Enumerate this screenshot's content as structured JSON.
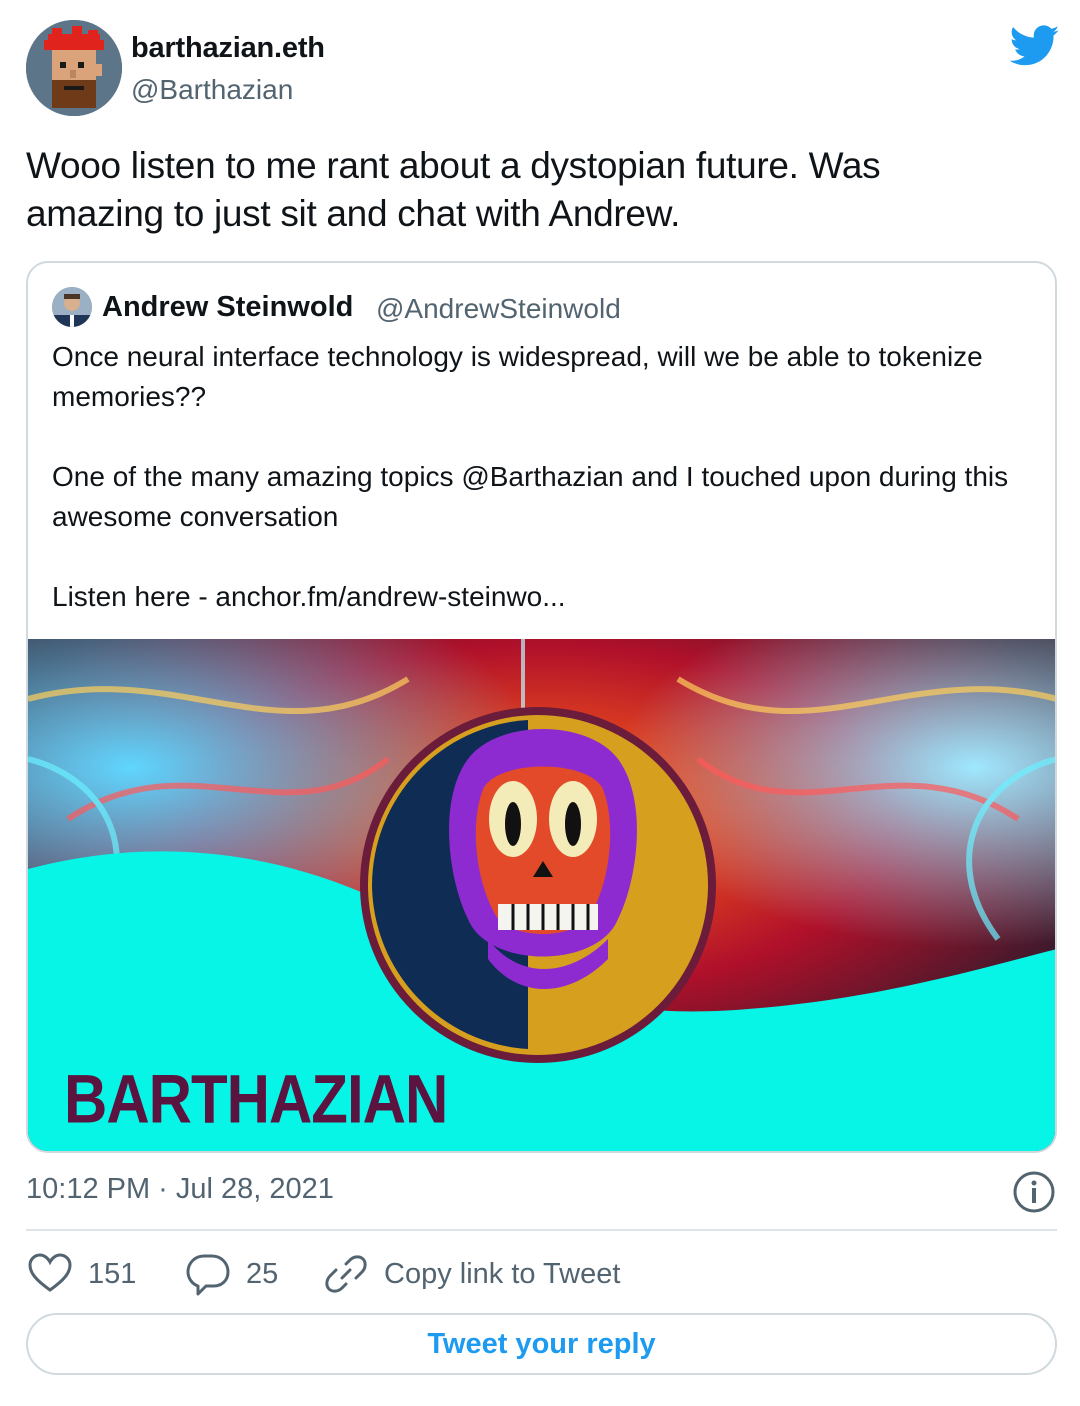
{
  "tweet": {
    "author": {
      "name": "barthazian.eth",
      "handle": "@Barthazian",
      "avatar_icon": "pixel-punk-avatar"
    },
    "text": "Wooo listen to me rant about a dystopian future. Was amazing to just sit and chat with Andrew.",
    "timestamp": "10:12 PM · Jul 28, 2021",
    "brand_icon": "twitter-bird-icon",
    "brand_color": "#1d9bf0"
  },
  "quoted": {
    "author": {
      "name": "Andrew Steinwold",
      "handle": "@AndrewSteinwold"
    },
    "text": "Once neural interface technology is widespread, will we be able to tokenize memories??\n\nOne of the many amazing topics @Barthazian and I touched upon during this awesome conversation\n\nListen here - anchor.fm/andrew-steinwo...",
    "media": {
      "overlay_text": "BARTHAZIAN",
      "accent_color": "#06f5e6",
      "text_color": "#5b1340"
    }
  },
  "actions": {
    "like_count": "151",
    "reply_count": "25",
    "copy_label": "Copy link to Tweet"
  },
  "reply_button": {
    "label": "Tweet your reply"
  }
}
